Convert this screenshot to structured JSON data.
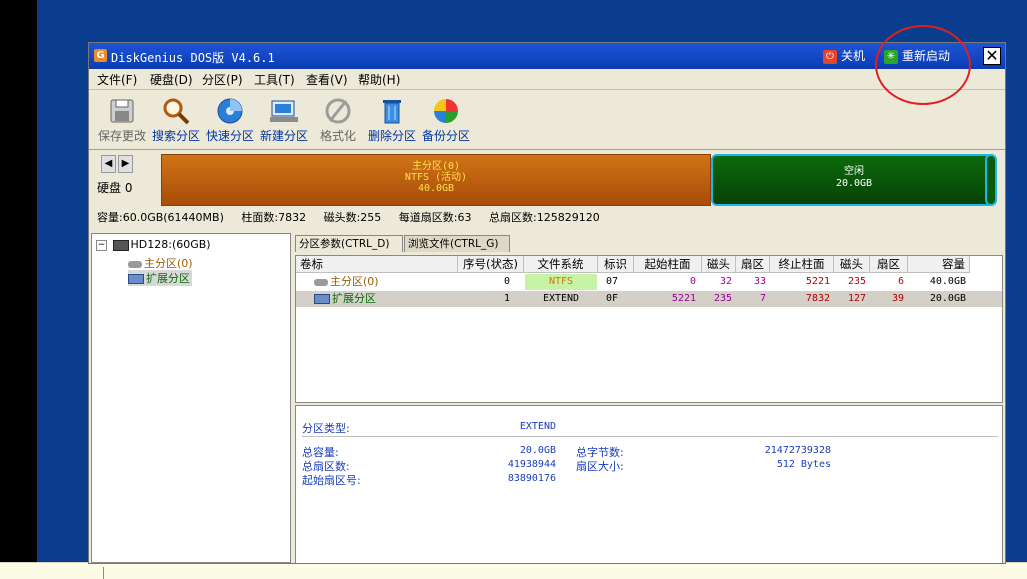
{
  "window": {
    "title": "DiskGenius DOS版 V4.6.1",
    "shutdown_label": "关机",
    "restart_label": "重新启动",
    "close_glyph": "✕"
  },
  "menu": [
    "文件(F)",
    "硬盘(D)",
    "分区(P)",
    "工具(T)",
    "查看(V)",
    "帮助(H)"
  ],
  "toolbar": [
    {
      "label": "保存更改",
      "icon": "save-icon",
      "enabled": false
    },
    {
      "label": "搜索分区",
      "icon": "search-icon",
      "enabled": true
    },
    {
      "label": "快速分区",
      "icon": "quick-partition-icon",
      "enabled": true
    },
    {
      "label": "新建分区",
      "icon": "new-partition-icon",
      "enabled": true
    },
    {
      "label": "格式化",
      "icon": "format-icon",
      "enabled": false
    },
    {
      "label": "删除分区",
      "icon": "delete-icon",
      "enabled": true
    },
    {
      "label": "备份分区",
      "icon": "backup-icon",
      "enabled": true
    }
  ],
  "diskmap": {
    "disk_label": "硬盘 0",
    "primary": {
      "name": "主分区(0)",
      "fs": "NTFS (活动)",
      "size": "40.0GB"
    },
    "free": {
      "name": "空闲",
      "size": "20.0GB"
    }
  },
  "diskinfo": {
    "capacity": "容量:60.0GB(61440MB)",
    "cylinders": "柱面数:7832",
    "heads": "磁头数:255",
    "sectors_per_track": "每道扇区数:63",
    "total_sectors": "总扇区数:125829120"
  },
  "tree": {
    "disk": "HD128:(60GB)",
    "primary": "主分区(0)",
    "extended": "扩展分区"
  },
  "tabs": [
    "分区参数(CTRL_D)",
    "浏览文件(CTRL_G)"
  ],
  "table": {
    "columns": [
      "卷标",
      "序号(状态)",
      "文件系统",
      "标识",
      "起始柱面",
      "磁头",
      "扇区",
      "终止柱面",
      "磁头",
      "扇区",
      "容量"
    ],
    "rows": [
      [
        "主分区(0)",
        "0",
        "NTFS",
        "07",
        "0",
        "32",
        "33",
        "5221",
        "235",
        "6",
        "40.0GB"
      ],
      [
        "扩展分区",
        "1",
        "EXTEND",
        "0F",
        "5221",
        "235",
        "7",
        "7832",
        "127",
        "39",
        "20.0GB"
      ]
    ]
  },
  "details": {
    "type_label": "分区类型:",
    "type_value": "EXTEND",
    "total_capacity_label": "总容量:",
    "total_capacity_value": "20.0GB",
    "total_bytes_label": "总字节数:",
    "total_bytes_value": "21472739328",
    "total_sectors_label": "总扇区数:",
    "total_sectors_value": "41938944",
    "sector_size_label": "扇区大小:",
    "sector_size_value": "512 Bytes",
    "start_sector_label": "起始扇区号:",
    "start_sector_value": "83890176"
  },
  "colors": {
    "titlebar": "#0b3cb3",
    "primary_partition": "#c0640f",
    "free_space": "#0a5a0a",
    "annotation": "#e02020"
  }
}
